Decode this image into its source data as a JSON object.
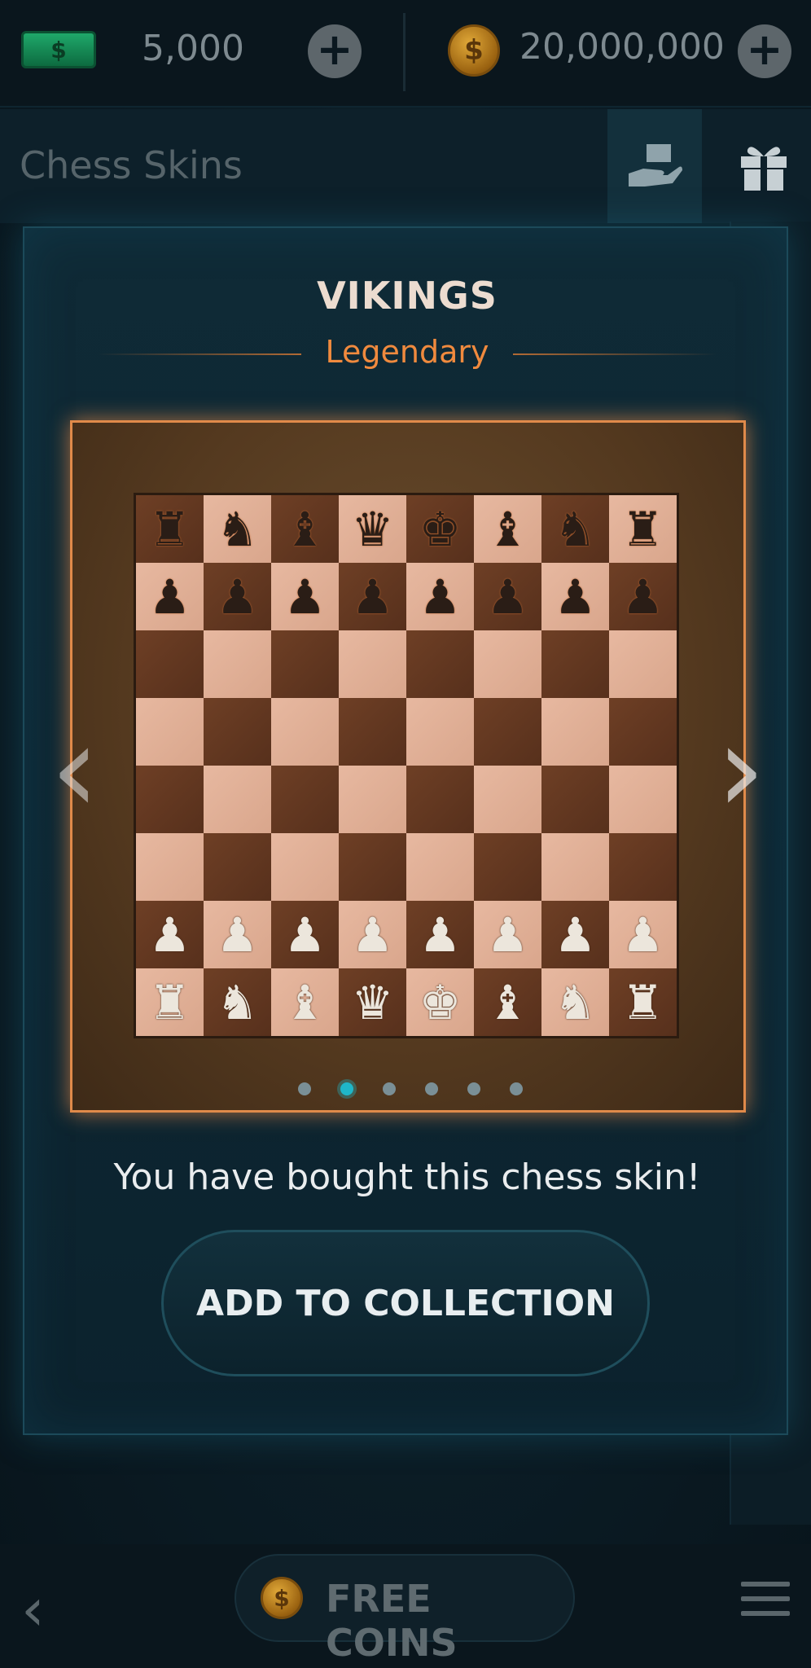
{
  "topbar": {
    "cash_symbol": "$",
    "cash_value": "5,000",
    "coin_symbol": "$",
    "coin_value": "20,000,000",
    "plus_label": "+"
  },
  "header": {
    "title": "Chess Skins"
  },
  "modal": {
    "skin_name": "VIKINGS",
    "rarity": "Legendary",
    "carousel": {
      "pages": 6,
      "active_index": 1
    },
    "status_text": "You have bought this chess skin!",
    "action_label": "ADD TO COLLECTION",
    "prev_arrow": "‹",
    "next_arrow": "›"
  },
  "board": {
    "rows": [
      [
        {
          "p": "♜",
          "c": "black"
        },
        {
          "p": "♞",
          "c": "black"
        },
        {
          "p": "♝",
          "c": "black"
        },
        {
          "p": "♛",
          "c": "black"
        },
        {
          "p": "♚",
          "c": "black"
        },
        {
          "p": "♝",
          "c": "black"
        },
        {
          "p": "♞",
          "c": "black"
        },
        {
          "p": "♜",
          "c": "black"
        }
      ],
      [
        {
          "p": "♟",
          "c": "black"
        },
        {
          "p": "♟",
          "c": "black"
        },
        {
          "p": "♟",
          "c": "black"
        },
        {
          "p": "♟",
          "c": "black"
        },
        {
          "p": "♟",
          "c": "black"
        },
        {
          "p": "♟",
          "c": "black"
        },
        {
          "p": "♟",
          "c": "black"
        },
        {
          "p": "♟",
          "c": "black"
        }
      ],
      [
        null,
        null,
        null,
        null,
        null,
        null,
        null,
        null
      ],
      [
        null,
        null,
        null,
        null,
        null,
        null,
        null,
        null
      ],
      [
        null,
        null,
        null,
        null,
        null,
        null,
        null,
        null
      ],
      [
        null,
        null,
        null,
        null,
        null,
        null,
        null,
        null
      ],
      [
        {
          "p": "♟",
          "c": "white"
        },
        {
          "p": "♟",
          "c": "white"
        },
        {
          "p": "♟",
          "c": "white"
        },
        {
          "p": "♟",
          "c": "white"
        },
        {
          "p": "♟",
          "c": "white"
        },
        {
          "p": "♟",
          "c": "white"
        },
        {
          "p": "♟",
          "c": "white"
        },
        {
          "p": "♟",
          "c": "white"
        }
      ],
      [
        {
          "p": "♜",
          "c": "white"
        },
        {
          "p": "♞",
          "c": "white"
        },
        {
          "p": "♝",
          "c": "white"
        },
        {
          "p": "♛",
          "c": "white"
        },
        {
          "p": "♚",
          "c": "white"
        },
        {
          "p": "♝",
          "c": "white"
        },
        {
          "p": "♞",
          "c": "white"
        },
        {
          "p": "♜",
          "c": "white"
        }
      ]
    ]
  },
  "bottombar": {
    "back_label": "‹",
    "free_coins_label": "FREE COINS",
    "coin_symbol": "$"
  },
  "colors": {
    "accent": "#1fb6c8",
    "rarity": "#f08a3e",
    "glow": "#e08a4a"
  }
}
